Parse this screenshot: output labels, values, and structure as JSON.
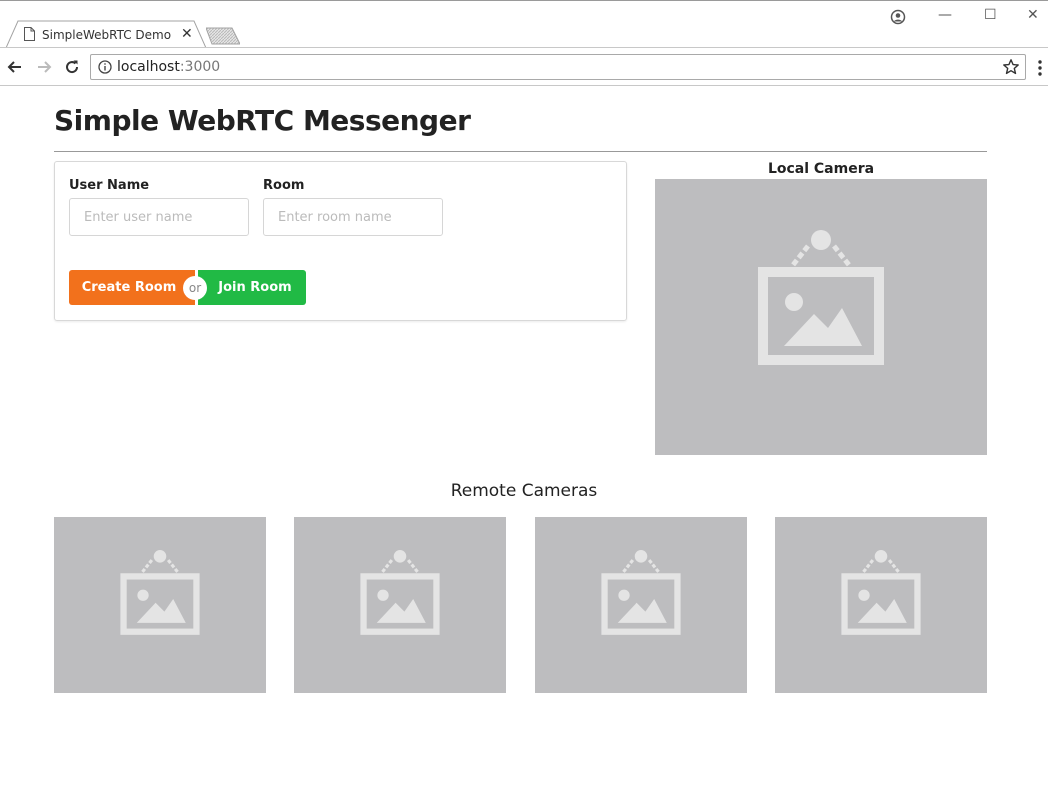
{
  "browser": {
    "tab_title": "SimpleWebRTC Demo",
    "tab_close": "✕",
    "url_host": "localhost",
    "url_port": ":3000",
    "window_controls": {
      "minimize": "—",
      "maximize": "☐",
      "close": "✕"
    }
  },
  "page": {
    "title": "Simple WebRTC Messenger",
    "form": {
      "username_label": "User Name",
      "username_placeholder": "Enter user name",
      "room_label": "Room",
      "room_placeholder": "Enter room name",
      "create_button": "Create Room",
      "or_text": "or",
      "join_button": "Join Room"
    },
    "local_camera_heading": "Local Camera",
    "remote_cameras_heading": "Remote Cameras"
  },
  "colors": {
    "create_button": "#f2711c",
    "join_button": "#21ba45",
    "camera_placeholder_bg": "#bdbdbf",
    "camera_placeholder_icon": "#e4e4e4"
  },
  "icons": {
    "tab": "document-icon",
    "nav_back": "back-arrow-icon",
    "nav_forward": "forward-arrow-icon",
    "reload": "reload-icon",
    "site_info": "info-icon",
    "bookmark": "star-icon",
    "menu": "kebab-menu-icon",
    "profile": "profile-icon",
    "camera_placeholder": "image-placeholder-icon"
  }
}
